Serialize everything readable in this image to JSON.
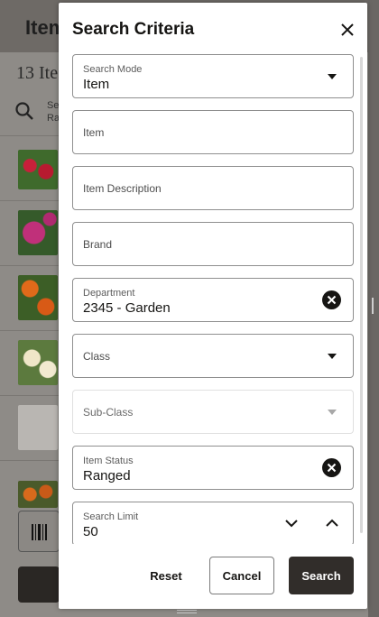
{
  "background": {
    "header_title": "Item",
    "count_text": "13 Ite",
    "search_summary_line1": "Se",
    "search_summary_line2": "Ra"
  },
  "dialog": {
    "title": "Search Criteria",
    "fields": {
      "search_mode": {
        "label": "Search Mode",
        "value": "Item"
      },
      "item": {
        "placeholder": "Item"
      },
      "item_description": {
        "placeholder": "Item Description"
      },
      "brand": {
        "placeholder": "Brand"
      },
      "department": {
        "label": "Department",
        "value": "2345 - Garden"
      },
      "class": {
        "placeholder": "Class"
      },
      "sub_class": {
        "placeholder": "Sub-Class"
      },
      "item_status": {
        "label": "Item Status",
        "value": "Ranged"
      },
      "search_limit": {
        "label": "Search Limit",
        "value": "50"
      }
    },
    "buttons": {
      "reset": "Reset",
      "cancel": "Cancel",
      "search": "Search"
    }
  },
  "colors": {
    "primary_button": "#312d2a",
    "text": "#161513",
    "overlay": "#8e8b87"
  },
  "icons": [
    "close-icon",
    "chevron-down-icon",
    "clear-icon",
    "chevron-up-icon",
    "search-icon",
    "barcode-icon"
  ]
}
